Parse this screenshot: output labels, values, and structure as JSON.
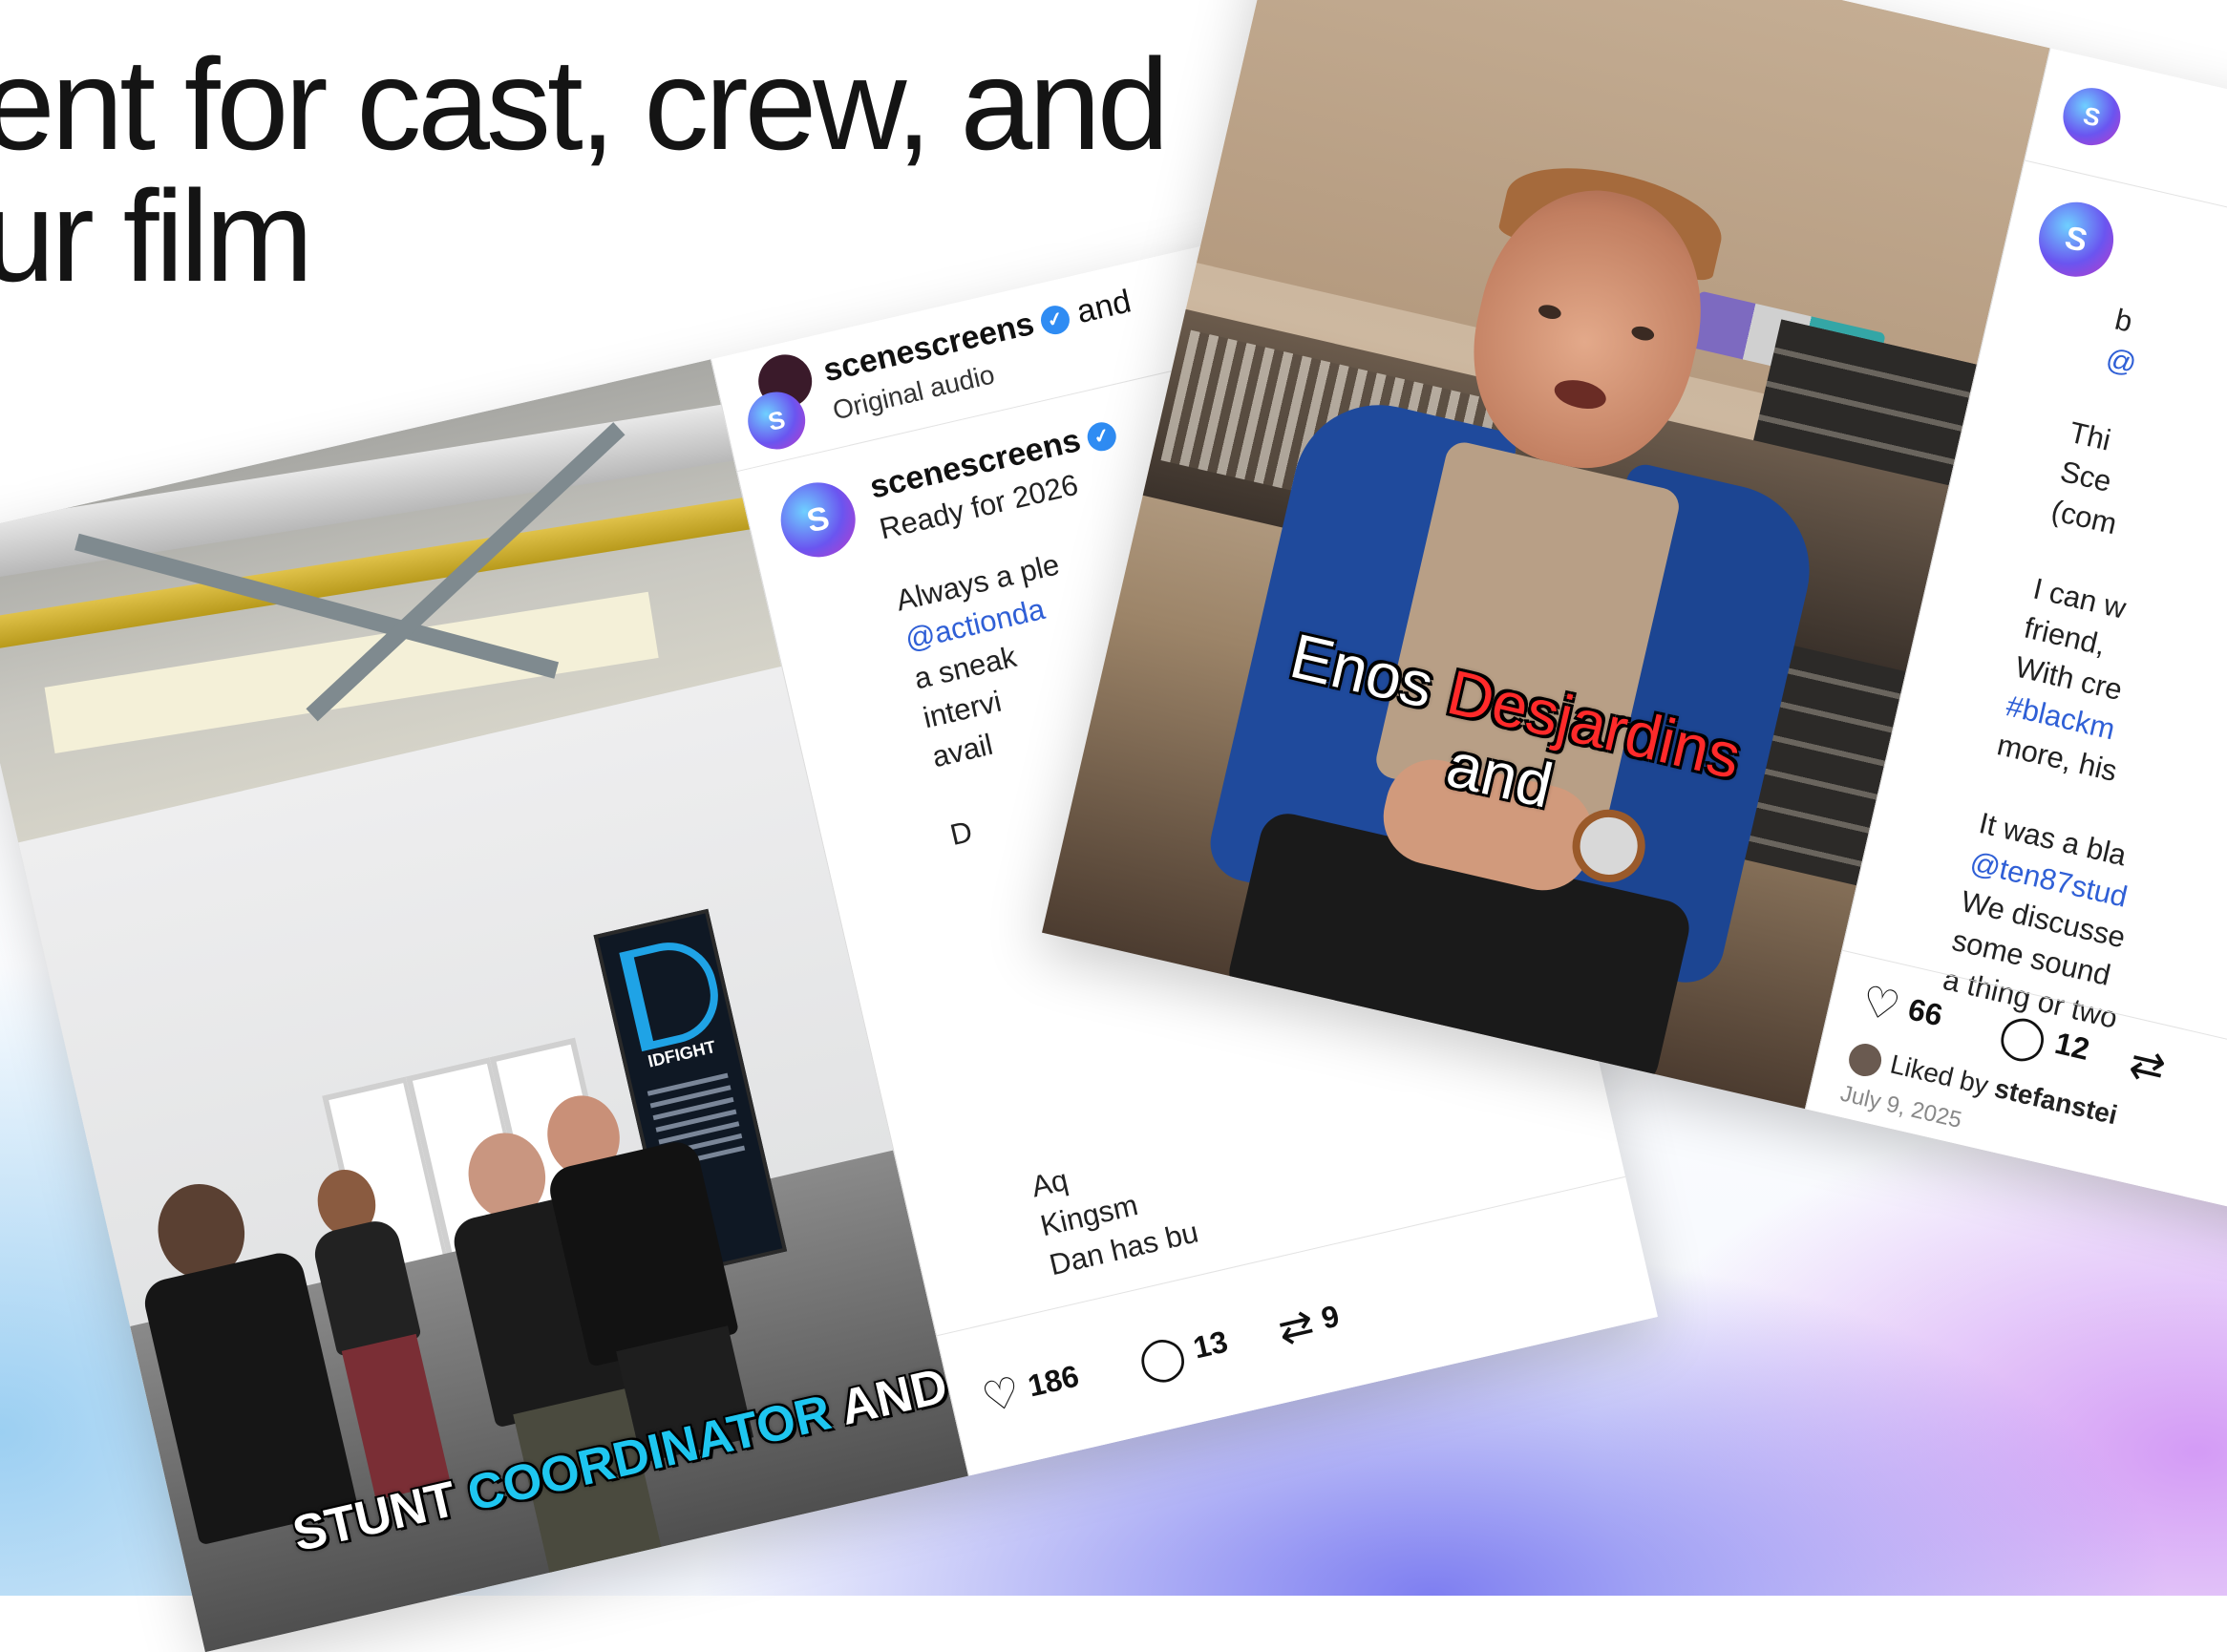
{
  "headline": {
    "line1": "ent for cast, crew, and",
    "line2": "ur film"
  },
  "post1": {
    "media_caption_pre": "STUNT ",
    "media_caption_highlight": "COORDINATOR",
    "media_caption_post": " AND",
    "banner_brand": "IDFIGHT",
    "header_username": "scenescreens",
    "header_collab": "and",
    "header_audio": "Original audio",
    "username": "scenescreens",
    "post_title": "Ready for 2026",
    "body_lines": [
      "Always a ple",
      "@actionda",
      "a sneak",
      "intervi",
      "avail"
    ],
    "body_letter": "D",
    "body_lower": [
      "Aq",
      "Kingsm",
      "Dan has bu"
    ],
    "likes": "186",
    "comments": "13",
    "reposts": "9"
  },
  "post2": {
    "caption_first": "Enos",
    "caption_last": "Desjardins",
    "caption_and": "and",
    "body_lines": [
      "b",
      "@",
      "",
      "Thi",
      "Sce",
      "(com",
      "",
      "I can w",
      "friend,",
      "With cre",
      "#blackm",
      "more, his",
      "",
      "It was a bla",
      "@ten87stud",
      "We discusse",
      "some sound",
      "a thing or two"
    ],
    "likes": "66",
    "comments": "12",
    "liked_by_prefix": "Liked by",
    "liked_by_user": "stefanstei",
    "date": "July 9, 2025"
  },
  "colors": {
    "caption_highlight": "#1ec6f0",
    "caption_name": "#ff2a2a",
    "link": "#2f5fd6",
    "verified": "#2f8cf3"
  }
}
